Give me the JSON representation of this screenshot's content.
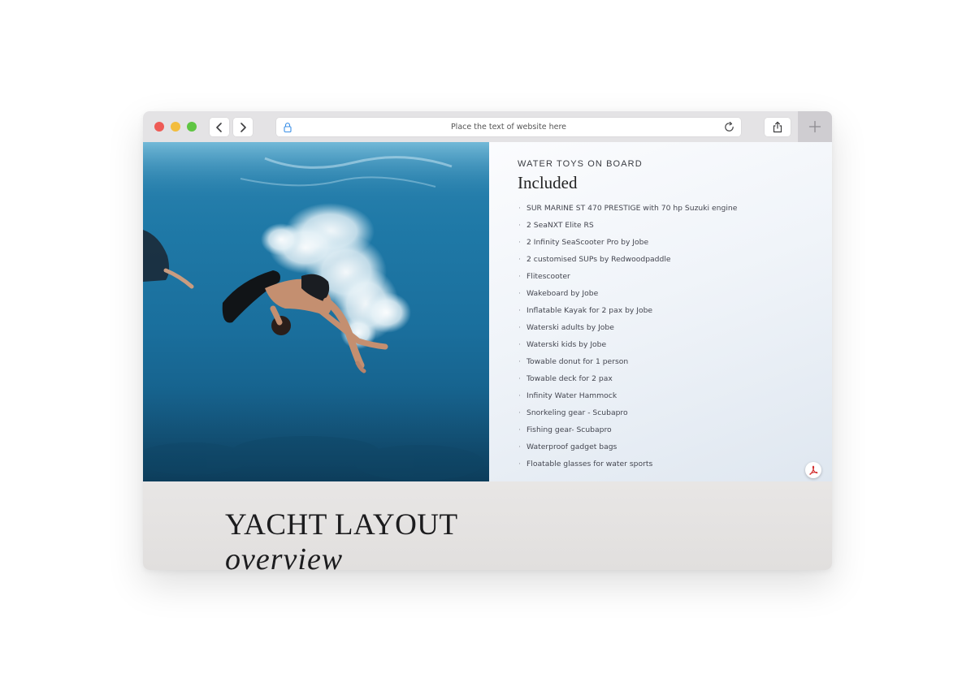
{
  "browser": {
    "url_placeholder": "Place the text of website here",
    "traffic_colors": {
      "close": "#ee5b56",
      "minimize": "#f3bd3e",
      "maximize": "#5fc543"
    },
    "accent_color": "#3b8fe6"
  },
  "photo": {
    "alt": "",
    "icon": "underwater-photo"
  },
  "toys": {
    "eyebrow": "WATER TOYS ON BOARD",
    "heading": "Included",
    "items": [
      "SUR MARINE ST 470 PRESTIGE with 70 hp Suzuki engine",
      "2 SeaNXT Elite RS",
      "2 Infinity SeaScooter Pro by Jobe",
      "2 customised SUPs by Redwoodpaddle",
      "Flitescooter",
      "Wakeboard by Jobe",
      "Inflatable Kayak for 2 pax by Jobe",
      "Waterski adults by Jobe",
      "Waterski kids by Jobe",
      "Towable donut for 1 person",
      "Towable deck for 2 pax",
      "Infinity Water Hammock",
      "Snorkeling gear - Scubapro",
      "Fishing gear- Scubapro",
      "Waterproof gadget bags",
      "Floatable glasses for water sports"
    ],
    "pdf_icon": "pdf-icon",
    "pdf_color": "#d32f2f"
  },
  "layout_section": {
    "title": "YACHT LAYOUT",
    "subtitle": "overview"
  }
}
